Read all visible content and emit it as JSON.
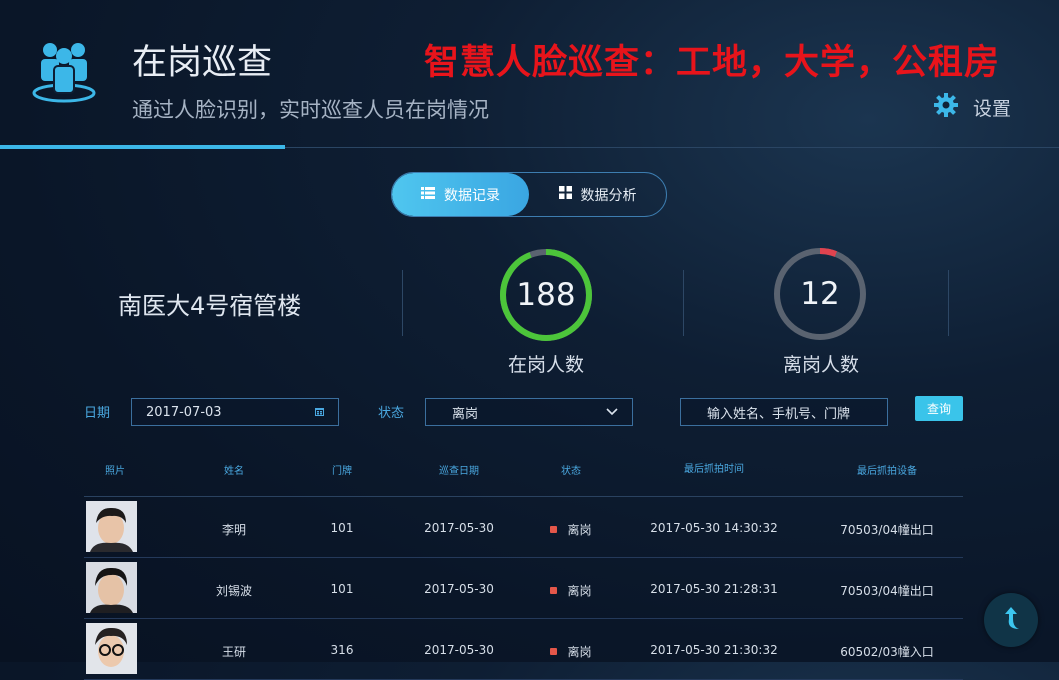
{
  "header": {
    "title": "在岗巡查",
    "subtitle": "通过人脸识别，实时巡查人员在岗情况",
    "banner": "智慧人脸巡查：工地，大学，公租房",
    "settings_label": "设置"
  },
  "tabs": [
    {
      "label": "数据记录",
      "active": true
    },
    {
      "label": "数据分析",
      "active": false
    }
  ],
  "stats": {
    "building": "南医大4号宿管楼",
    "on_duty": {
      "value": "188",
      "label": "在岗人数",
      "fraction": 0.94,
      "color": "#4cc53a"
    },
    "off_duty": {
      "value": "12",
      "label": "离岗人数",
      "fraction": 0.06,
      "color": "#e0434f"
    }
  },
  "filters": {
    "date_label": "日期",
    "date_value": "2017-07-03",
    "status_label": "状态",
    "status_value": "离岗",
    "search_placeholder": "输入姓名、手机号、门牌",
    "query_label": "查询"
  },
  "table": {
    "headers": [
      "照片",
      "姓名",
      "门牌",
      "巡查日期",
      "状态",
      "最后抓拍时间",
      "最后抓拍设备"
    ],
    "rows": [
      {
        "name": "李明",
        "door": "101",
        "date": "2017-05-30",
        "status": "离岗",
        "time": "2017-05-30  14:30:32",
        "device": "70503/04幢出口"
      },
      {
        "name": "刘锡波",
        "door": "101",
        "date": "2017-05-30",
        "status": "离岗",
        "time": "2017-05-30  21:28:31",
        "device": "70503/04幢出口"
      },
      {
        "name": "王研",
        "door": "316",
        "date": "2017-05-30",
        "status": "离岗",
        "time": "2017-05-30  21:30:32",
        "device": "60502/03幢入口"
      }
    ]
  },
  "colors": {
    "accent": "#3cb7e8",
    "banner": "#e8141b",
    "status_off": "#e4574a"
  },
  "icons": [
    "people-logo-icon",
    "gear-icon",
    "list-icon",
    "grid-icon",
    "calendar-icon",
    "chevron-down-icon",
    "back-arrow-icon"
  ]
}
